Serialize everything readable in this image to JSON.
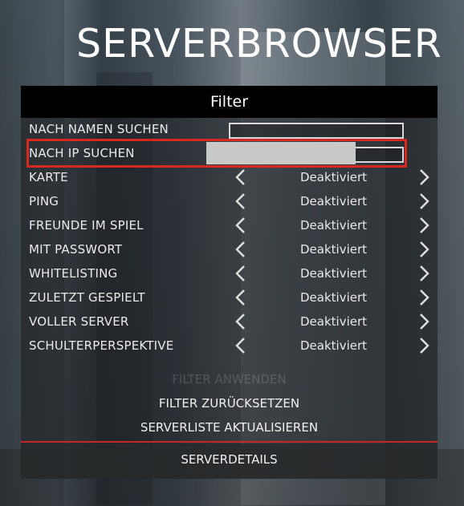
{
  "page": {
    "title": "SERVERBROWSER"
  },
  "filter_panel": {
    "header": "Filter",
    "text_filters": [
      {
        "label": "NACH NAMEN SUCHEN",
        "value": ""
      },
      {
        "label": "NACH IP SUCHEN",
        "value": ""
      }
    ],
    "toggle_filters": [
      {
        "label": "KARTE",
        "value": "Deaktiviert"
      },
      {
        "label": "PING",
        "value": "Deaktiviert"
      },
      {
        "label": "FREUNDE IM SPIEL",
        "value": "Deaktiviert"
      },
      {
        "label": "MIT PASSWORT",
        "value": "Deaktiviert"
      },
      {
        "label": "WHITELISTING",
        "value": "Deaktiviert"
      },
      {
        "label": "ZULETZT GESPIELT",
        "value": "Deaktiviert"
      },
      {
        "label": "VOLLER SERVER",
        "value": "Deaktiviert"
      },
      {
        "label": "SCHULTERPERSPEKTIVE",
        "value": "Deaktiviert"
      }
    ],
    "actions": {
      "apply": "FILTER ANWENDEN",
      "reset": "FILTER ZURÜCKSETZEN",
      "refresh": "SERVERLISTE AKTUALISIEREN"
    },
    "details": "SERVERDETAILS"
  },
  "colors": {
    "highlight": "#d62a20",
    "divider": "#c8242b",
    "header_bg": "#000000"
  },
  "icons": {
    "prev": "chevron-left-icon",
    "next": "chevron-right-icon"
  }
}
